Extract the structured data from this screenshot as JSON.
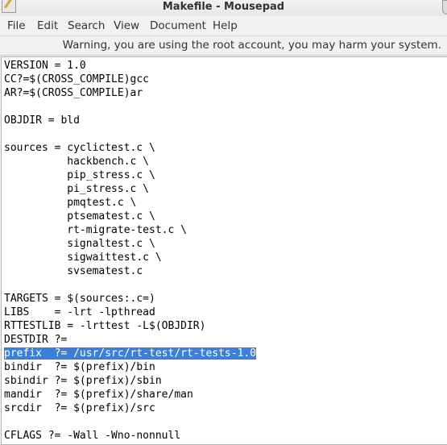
{
  "window": {
    "title": "Makefile - Mousepad"
  },
  "menu": [
    {
      "label": "File"
    },
    {
      "label": "Edit"
    },
    {
      "label": "Search"
    },
    {
      "label": "View"
    },
    {
      "label": "Document"
    },
    {
      "label": "Help"
    }
  ],
  "warning": "Warning, you are using the root account, you may harm your system.",
  "editor": {
    "lines": [
      "VERSION = 1.0",
      "CC?=$(CROSS_COMPILE)gcc",
      "AR?=$(CROSS_COMPILE)ar",
      "",
      "OBJDIR = bld",
      "",
      "sources = cyclictest.c \\",
      "          hackbench.c \\",
      "          pip_stress.c \\",
      "          pi_stress.c \\",
      "          pmqtest.c \\",
      "          ptsematest.c \\",
      "          rt-migrate-test.c \\",
      "          signaltest.c \\",
      "          sigwaittest.c \\",
      "          svsematest.c",
      "",
      "TARGETS = $(sources:.c=)",
      "LIBS    = -lrt -lpthread",
      "RTTESTLIB = -lrttest -L$(OBJDIR)",
      "DESTDIR ?=",
      "prefix  ?= /usr/src/rt-test/rt-tests-1.0",
      "bindir  ?= $(prefix)/bin",
      "sbindir ?= $(prefix)/sbin",
      "mandir  ?= $(prefix)/share/man",
      "srcdir  ?= $(prefix)/src",
      "",
      "CFLAGS ?= -Wall -Wno-nonnull"
    ],
    "selected_line": 21,
    "selection_color": "#3a80d8"
  }
}
